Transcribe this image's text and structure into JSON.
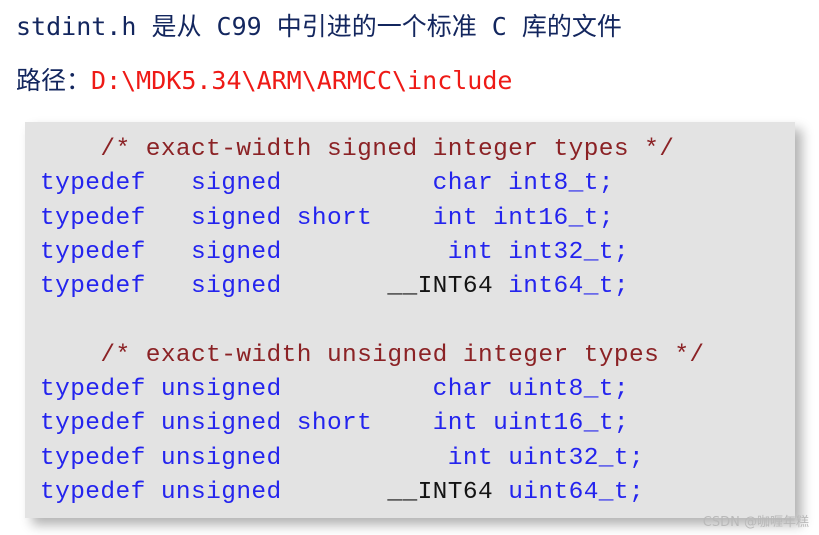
{
  "header": {
    "line1": "stdint.h 是从 C99 中引进的一个标准 C 库的文件",
    "line2_label": "路径：",
    "line2_path": "D:\\MDK5.34\\ARM\\ARMCC\\include",
    "text_color": "#13265e",
    "path_color": "#ee1a16"
  },
  "code_block": {
    "background": "#e3e3e3",
    "comment_color": "#8b2225",
    "keyword_color": "#2424ee",
    "plain_color": "#141414",
    "lines": [
      {
        "indent": "    ",
        "comment": "/* exact-width signed integer types */"
      },
      {
        "kw1": "typedef   signed",
        "pad1": "          ",
        "plain": "",
        "kw2": "char int8_t;"
      },
      {
        "kw1": "typedef   signed short",
        "pad1": "    ",
        "plain": "",
        "kw2": "int int16_t;"
      },
      {
        "kw1": "typedef   signed",
        "pad1": "           ",
        "plain": "",
        "kw2": "int int32_t;"
      },
      {
        "kw1": "typedef   signed",
        "pad1": "       ",
        "plain": "__INT64 ",
        "kw2": "int64_t;"
      },
      {
        "blank": true
      },
      {
        "indent": "    ",
        "comment": "/* exact-width unsigned integer types */"
      },
      {
        "kw1": "typedef unsigned",
        "pad1": "          ",
        "plain": "",
        "kw2": "char uint8_t;"
      },
      {
        "kw1": "typedef unsigned short",
        "pad1": "    ",
        "plain": "",
        "kw2": "int uint16_t;"
      },
      {
        "kw1": "typedef unsigned",
        "pad1": "           ",
        "plain": "",
        "kw2": "int uint32_t;"
      },
      {
        "kw1": "typedef unsigned",
        "pad1": "       ",
        "plain": "__INT64 ",
        "kw2": "uint64_t;"
      }
    ]
  },
  "watermark": {
    "text": "CSDN @咖喱年糕"
  }
}
